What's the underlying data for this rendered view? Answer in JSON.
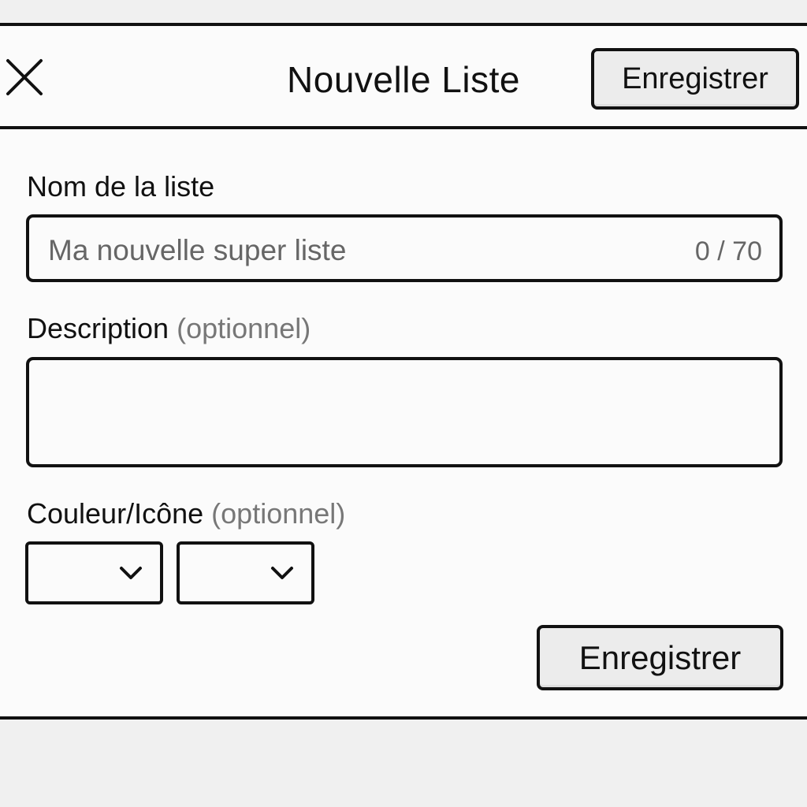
{
  "header": {
    "title": "Nouvelle Liste",
    "close_icon": "close-icon",
    "save_label": "Enregistrer"
  },
  "form": {
    "name": {
      "label": "Nom de la liste",
      "placeholder": "Ma nouvelle super liste",
      "value": "",
      "counter": "0 / 70"
    },
    "description": {
      "label": "Description",
      "optional": "(optionnel)",
      "value": ""
    },
    "color_icon": {
      "label": "Couleur/Icône",
      "optional": "(optionnel)",
      "color_select_icon": "chevron-down-icon",
      "icon_select_icon": "chevron-down-icon"
    },
    "save_label": "Enregistrer"
  },
  "colors": {
    "border": "#111111",
    "button_bg": "#ececec",
    "dialog_bg": "#fbfbfb",
    "page_bg": "#f0f0f0",
    "muted_text": "#777777"
  }
}
